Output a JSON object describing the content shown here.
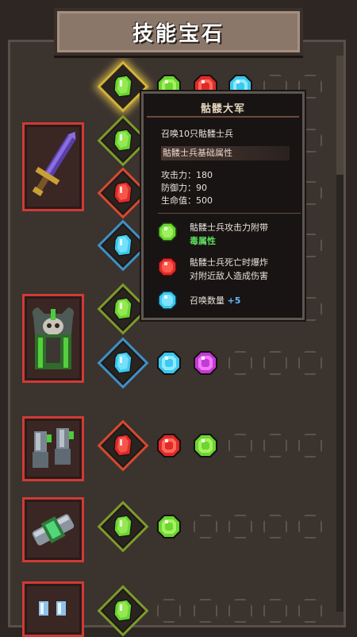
{
  "title": "技能宝石",
  "equipment": [
    {
      "name": "紫色巨剑",
      "icon": "sword-icon"
    },
    {
      "name": "骷髅胸甲",
      "icon": "armor-icon"
    },
    {
      "name": "护手",
      "icon": "gauntlet-icon"
    },
    {
      "name": "腰带",
      "icon": "belt-icon"
    },
    {
      "name": "护符",
      "icon": "charm-icon"
    }
  ],
  "tooltip": {
    "title": "骷髅大军",
    "summon": "召唤10只骷髅士兵",
    "base_band": "骷髅士兵基础属性",
    "atk": "攻击力：180",
    "def": "防御力：90",
    "hp": "生命值：500",
    "effect1_line1": "骷髅士兵攻击力附带",
    "effect1_line2": "毒属性",
    "effect2_line1": "骷髅士兵死亡时爆炸",
    "effect2_line2": "对附近敌人造成伤害",
    "effect3_text": "召唤数量",
    "effect3_value": "+5"
  },
  "colors": {
    "green_gem": "#6ad632",
    "red_gem": "#e02a2a",
    "cyan_gem": "#3cc8f0",
    "purple_gem": "#c43ad6",
    "equip_border": "#d03a35",
    "gold_frame": "#d4b437",
    "red_frame": "#d44a30",
    "blue_frame": "#3f8fc5",
    "olive_frame": "#7d9a2a"
  }
}
